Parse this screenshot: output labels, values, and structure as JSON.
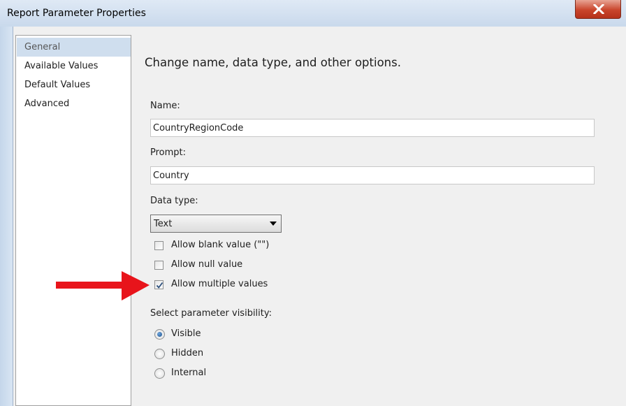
{
  "window": {
    "title": "Report Parameter Properties"
  },
  "colors": {
    "arrow": "#e8141b",
    "selected_nav": "#cfdeee",
    "close_button": "#c9452c"
  },
  "nav": {
    "items": [
      {
        "label": "General",
        "selected": true
      },
      {
        "label": "Available Values",
        "selected": false
      },
      {
        "label": "Default Values",
        "selected": false
      },
      {
        "label": "Advanced",
        "selected": false
      }
    ]
  },
  "general": {
    "heading": "Change name, data type, and other options.",
    "name_label": "Name:",
    "name_value": "CountryRegionCode",
    "prompt_label": "Prompt:",
    "prompt_value": "Country",
    "datatype_label": "Data type:",
    "datatype_value": "Text",
    "checkboxes": [
      {
        "label": "Allow blank value (\"\")",
        "checked": false
      },
      {
        "label": "Allow null value",
        "checked": false
      },
      {
        "label": "Allow multiple values",
        "checked": true
      }
    ],
    "visibility_label": "Select parameter visibility:",
    "visibility_options": [
      {
        "label": "Visible",
        "selected": true
      },
      {
        "label": "Hidden",
        "selected": false
      },
      {
        "label": "Internal",
        "selected": false
      }
    ]
  },
  "icons": {
    "close": "close-icon",
    "checkmark": "checkmark-icon",
    "annotation": "red-arrow-icon",
    "dropdown": "chevron-down-icon"
  }
}
